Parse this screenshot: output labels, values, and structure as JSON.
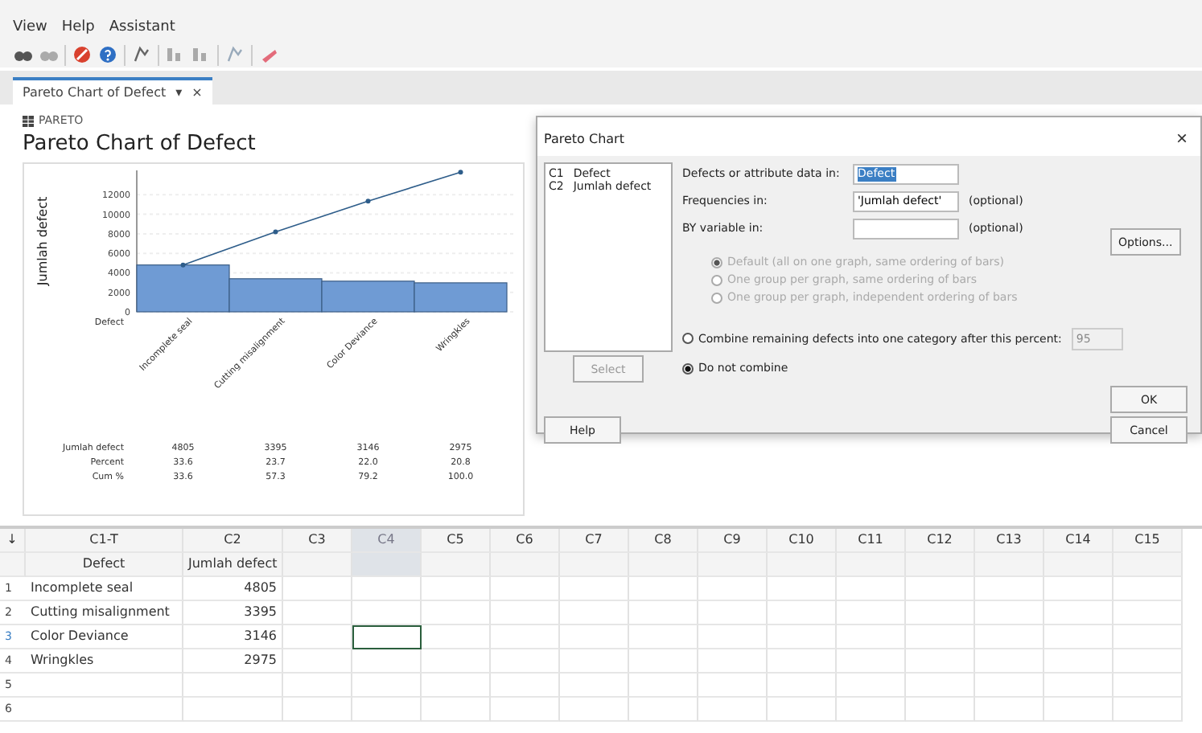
{
  "menu": [
    "View",
    "Help",
    "Assistant"
  ],
  "tab": {
    "label": "Pareto Chart of Defect",
    "caret": "▾",
    "close": "×"
  },
  "panel": {
    "label": "PARETO",
    "title": "Pareto Chart of Defect",
    "chart_data": {
      "type": "bar",
      "ylabel": "Jumlah defect",
      "xlabel": "Defect",
      "categories": [
        "Incomplete seal",
        "Cutting misalignment",
        "Color Deviance",
        "Wringkles"
      ],
      "series": [
        {
          "color": "#6f9bd4",
          "values": [
            4805,
            3395,
            3146,
            2975
          ]
        },
        {
          "type": "line",
          "marker": true,
          "color": "#2e5d8a",
          "values": [
            4805,
            8200,
            11346,
            14321
          ]
        }
      ],
      "grid": true,
      "ylim": [
        0,
        14500
      ],
      "yticks": [
        0,
        2000,
        4000,
        6000,
        8000,
        10000,
        12000
      ]
    },
    "stats": [
      {
        "label": "Jumlah defect",
        "values": [
          "4805",
          "3395",
          "3146",
          "2975"
        ]
      },
      {
        "label": "Percent",
        "values": [
          "33.6",
          "23.7",
          "22.0",
          "20.8"
        ]
      },
      {
        "label": "Cum %",
        "values": [
          "33.6",
          "57.3",
          "79.2",
          "100.0"
        ]
      }
    ]
  },
  "dialog": {
    "title": "Pareto Chart",
    "close": "×",
    "variables": [
      {
        "id": "C1",
        "name": "Defect"
      },
      {
        "id": "C2",
        "name": "Jumlah defect"
      }
    ],
    "fields": [
      {
        "label": "Defects or attribute data in:",
        "value": "Defect",
        "highlighted": true
      },
      {
        "label": "Frequencies in:",
        "value": "'Jumlah defect'",
        "note": "(optional)",
        "highlighted": false
      },
      {
        "label": "BY variable in:",
        "note": "(optional)",
        "highlighted": false
      }
    ],
    "group_options": [
      {
        "label": "Default (all on one graph, same ordering of bars)",
        "selected": true,
        "disabled": true
      },
      {
        "label": "One group per graph, same ordering of bars",
        "selected": false,
        "disabled": true
      },
      {
        "label": "One group per graph, independent ordering of bars",
        "selected": false,
        "disabled": true
      }
    ],
    "combine_options": [
      {
        "label": "Combine remaining defects into one category after this percent:",
        "selected": false,
        "value": "95"
      },
      {
        "label": "Do not combine",
        "selected": true
      }
    ],
    "buttons": {
      "select": {
        "label": "Select",
        "disabled": true
      },
      "help": "Help",
      "options": "Options...",
      "ok": "OK",
      "cancel": "Cancel"
    }
  },
  "sheet": {
    "corner": "↓",
    "columns": [
      {
        "id": "C1-T",
        "name": "Defect"
      },
      {
        "id": "C2",
        "name": "Jumlah defect"
      },
      {
        "id": "C3"
      },
      {
        "id": "C4",
        "selected": true
      },
      {
        "id": "C5"
      },
      {
        "id": "C6"
      },
      {
        "id": "C7"
      },
      {
        "id": "C8"
      },
      {
        "id": "C9"
      },
      {
        "id": "C10"
      },
      {
        "id": "C11"
      },
      {
        "id": "C12"
      },
      {
        "id": "C13"
      },
      {
        "id": "C14"
      },
      {
        "id": "C15"
      }
    ],
    "rows": [
      {
        "n": "1",
        "cells": [
          "Incomplete seal",
          "4805"
        ]
      },
      {
        "n": "2",
        "cells": [
          "Cutting misalignment",
          "3395"
        ]
      },
      {
        "n": "3",
        "cells": [
          "Color Deviance",
          "3146"
        ],
        "selected": true
      },
      {
        "n": "4",
        "cells": [
          "Wringkles",
          "2975"
        ]
      },
      {
        "n": "5",
        "cells": []
      },
      {
        "n": "6",
        "cells": []
      }
    ]
  }
}
